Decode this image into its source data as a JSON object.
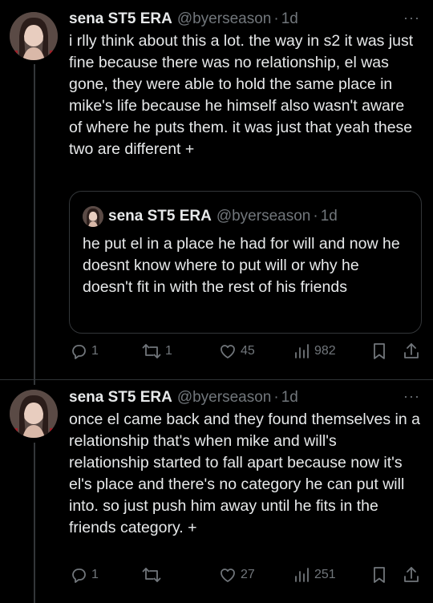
{
  "tweets": [
    {
      "name": "sena ST5 ERA",
      "handle": "@byerseason",
      "time": "1d",
      "text": "i rlly think about this a lot. the way in s2 it was just fine because there was no relationship, el was gone, they were able to hold the same place in mike's life because he himself also wasn't aware of where he puts them. it was just that yeah these two are different +",
      "quote": {
        "name": "sena ST5 ERA",
        "handle": "@byerseason",
        "time": "1d",
        "text": "he put el in a place he had for will and now he doesnt know where to put will or why he doesn't fit in with the rest of his friends"
      },
      "replies": "1",
      "retweets": "1",
      "likes": "45",
      "views": "982"
    },
    {
      "name": "sena ST5 ERA",
      "handle": "@byerseason",
      "time": "1d",
      "text": "once el came back and they found themselves in a relationship that's when mike and will's relationship started to fall apart because now it's el's place and there's no category he can put will into. so just push him away until he fits in the friends category. +",
      "replies": "1",
      "retweets": "",
      "likes": "27",
      "views": "251"
    }
  ],
  "separator": "·",
  "more_glyph": "···",
  "colors": {
    "background": "#000000",
    "text": "#e7e9ea",
    "muted": "#71767b",
    "border": "#333639"
  }
}
